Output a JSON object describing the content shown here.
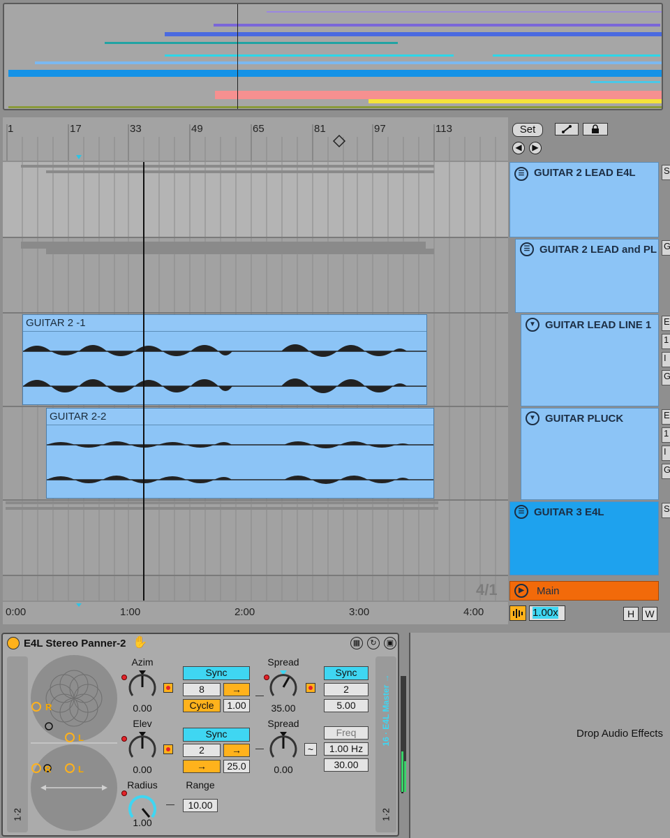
{
  "overview": {
    "label": "arrangement-overview"
  },
  "ruler": {
    "bars": [
      "1",
      "17",
      "33",
      "49",
      "65",
      "81",
      "97",
      "113"
    ],
    "loop_icon": "loop-brace-icon"
  },
  "set_panel": {
    "set_label": "Set",
    "draw_icon": "pencil-icon",
    "lock_icon": "lock-icon",
    "prev_icon": "arrow-left-circle-icon",
    "next_icon": "arrow-right-circle-icon"
  },
  "clips": [
    {
      "name": "GUITAR 2 -1"
    },
    {
      "name": "GUITAR 2-2"
    }
  ],
  "track_headers": [
    {
      "name": "GUITAR 2 LEAD E4L",
      "icon": "group-icon"
    },
    {
      "name": "GUITAR 2 LEAD and PL",
      "icon": "group-icon"
    },
    {
      "name": "GUITAR LEAD LINE 1",
      "icon": "fold-down-icon"
    },
    {
      "name": "GUITAR PLUCK",
      "icon": "fold-down-icon"
    },
    {
      "name": "GUITAR 3 E4L",
      "icon": "group-icon"
    },
    {
      "name": "Main",
      "icon": "play-circle-icon"
    }
  ],
  "side_letters": [
    "S",
    "G",
    "E",
    "1",
    "I",
    "G",
    "E",
    "1",
    "I",
    "G",
    "S"
  ],
  "grid": {
    "label": "4/1"
  },
  "timeline": [
    "0:00",
    "1:00",
    "2:00",
    "3:00",
    "4:00"
  ],
  "bottom_bar": {
    "zoom": "1.00x",
    "h_label": "H",
    "w_label": "W",
    "wave_icon": "waveform-icon"
  },
  "device": {
    "title": "E4L Stereo Panner-2",
    "hand_icon": "hand-icon",
    "header_icons": [
      "grid-icon",
      "refresh-icon",
      "save-icon"
    ],
    "pan_labels": {
      "r1": "R",
      "l1": "L",
      "r2": "R",
      "l2": "L"
    },
    "routing": "16 · E4L Master →",
    "io_left": "1·2",
    "io_right": "1·2",
    "azim": {
      "label": "Azim",
      "value": "0.00",
      "sync": "Sync",
      "rate": "8",
      "arrow": "→",
      "cycle": "Cycle",
      "cycle_val": "1.00"
    },
    "elev": {
      "label": "Elev",
      "value": "0.00",
      "sync": "Sync",
      "rate": "2",
      "arrow": "→",
      "arrow2": "→",
      "val2": "25.0"
    },
    "radius": {
      "label": "Radius",
      "value": "1.00",
      "range_label": "Range",
      "range_val": "10.00"
    },
    "spread1": {
      "label": "Spread",
      "value": "35.00",
      "sync": "Sync",
      "rate": "2",
      "val": "5.00"
    },
    "spread2": {
      "label": "Spread",
      "value": "0.00",
      "wave": "~",
      "freq": "Freq",
      "hz": "1.00 Hz",
      "val": "30.00"
    }
  },
  "drop_zone": {
    "text": "Drop Audio Effects"
  },
  "colors": {
    "clip": "#8cc4f6",
    "main": "#f26a0a",
    "accent_yellow": "#ffb21c",
    "accent_cyan": "#3fd6f2"
  }
}
